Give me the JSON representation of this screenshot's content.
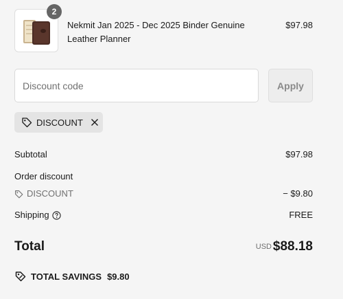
{
  "product": {
    "quantity": "2",
    "name": "Nekmit Jan 2025 - Dec 2025 Binder Genuine Leather Planner",
    "price": "$97.98",
    "thumbnail_icon": "leather-planner-thumbnail"
  },
  "discount": {
    "placeholder": "Discount code",
    "value": "",
    "apply_label": "Apply",
    "applied_code": "DISCOUNT"
  },
  "summary": {
    "subtotal_label": "Subtotal",
    "subtotal_value": "$97.98",
    "order_discount_label": "Order discount",
    "discount_code": "DISCOUNT",
    "discount_value": "− $9.80",
    "shipping_label": "Shipping",
    "shipping_value": "FREE",
    "total_label": "Total",
    "currency": "USD",
    "total_value": "$88.18",
    "savings_label": "TOTAL SAVINGS",
    "savings_value": "$9.80"
  },
  "colors": {
    "background": "#f5f5f5",
    "muted_text": "#707070",
    "badge": "#666666"
  }
}
